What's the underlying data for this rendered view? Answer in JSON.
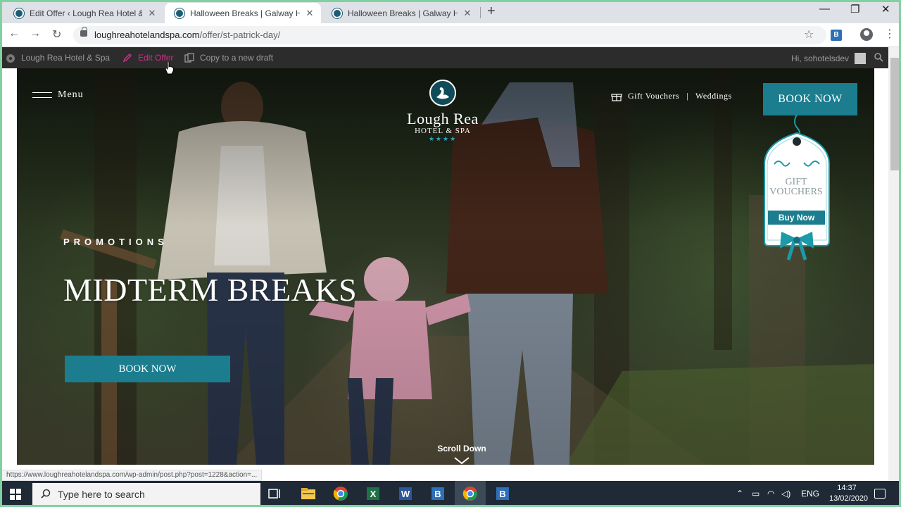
{
  "browser": {
    "tabs": [
      {
        "title": "Edit Offer ‹ Lough Rea Hotel & Spa",
        "active": false
      },
      {
        "title": "Halloween Breaks | Galway Hotel",
        "active": true
      },
      {
        "title": "Halloween Breaks | Galway Hotel",
        "active": false
      }
    ],
    "url_host": "loughreahotelandspa.com",
    "url_path": "/offer/st-patrick-day/",
    "extension_label": "B",
    "status_url": "https://www.loughreahotelandspa.com/wp-admin/post.php?post=1228&action=..."
  },
  "adminbar": {
    "site_name": "Lough Rea Hotel & Spa",
    "edit_label": "Edit Offer",
    "copy_label": "Copy to a new draft",
    "greeting": "Hi, sohotelsdev"
  },
  "site": {
    "menu_label": "Menu",
    "logo_name": "Lough Rea",
    "logo_sub": "HOTEL & SPA",
    "logo_stars": "★★★★",
    "gift_vouchers_link": "Gift Vouchers",
    "separator": "|",
    "weddings_link": "Weddings",
    "book_now_top": "BOOK NOW",
    "voucher_title_1": "GIFT",
    "voucher_title_2": "VOUCHERS",
    "voucher_button": "Buy Now",
    "promo_label": "PROMOTIONS",
    "headline": "MIDTERM BREAKS",
    "book_now_hero": "BOOK NOW",
    "scroll_down": "Scroll Down"
  },
  "taskbar": {
    "search_placeholder": "Type here to search",
    "language": "ENG",
    "time": "14:37",
    "date": "13/02/2020"
  },
  "colors": {
    "accent_teal": "#1b7d8e",
    "admin_edit_pink": "#d12f86",
    "admin_bar_bg": "#2c2c2c"
  }
}
